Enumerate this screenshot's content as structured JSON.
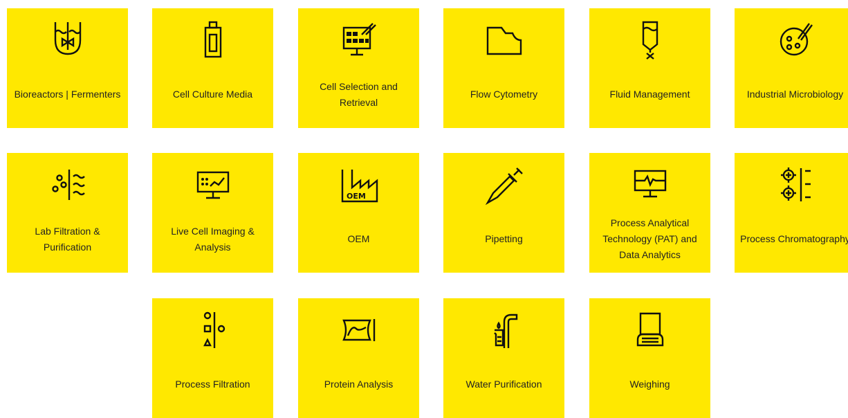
{
  "colors": {
    "tile_background": "#FFE800",
    "icon": "#111111",
    "text": "#222222"
  },
  "tiles": [
    {
      "label": "Bioreactors | Fermenters",
      "icon": "bioreactor-icon"
    },
    {
      "label": "Cell Culture Media",
      "icon": "media-bottle-icon"
    },
    {
      "label": "Cell Selection and Retrieval",
      "icon": "cell-selection-monitor-icon"
    },
    {
      "label": "Flow Cytometry",
      "icon": "flow-cytometry-icon"
    },
    {
      "label": "Fluid Management",
      "icon": "fluid-bag-icon"
    },
    {
      "label": "Industrial Microbiology",
      "icon": "petri-dish-icon"
    },
    {
      "label": "Lab Filtration & Purification",
      "icon": "lab-filtration-icon"
    },
    {
      "label": "Live Cell Imaging & Analysis",
      "icon": "imaging-monitor-icon"
    },
    {
      "label": "OEM",
      "icon": "oem-factory-icon",
      "icon_text": "OEM"
    },
    {
      "label": "Pipetting",
      "icon": "pipette-icon"
    },
    {
      "label": "Process Analytical Technology (PAT) and Data Analytics",
      "icon": "pat-monitor-icon"
    },
    {
      "label": "Process Chromatography",
      "icon": "chromatography-icon"
    },
    {
      "label": "Process Filtration",
      "icon": "process-filtration-icon"
    },
    {
      "label": "Protein Analysis",
      "icon": "protein-analysis-icon"
    },
    {
      "label": "Water Purification",
      "icon": "water-purification-icon"
    },
    {
      "label": "Weighing",
      "icon": "weighing-scale-icon"
    }
  ]
}
